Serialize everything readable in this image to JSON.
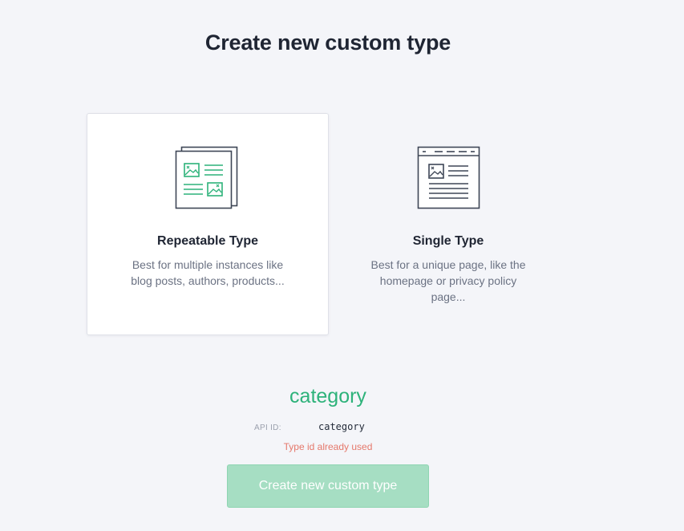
{
  "page_title": "Create new custom type",
  "types": [
    {
      "title": "Repeatable Type",
      "description": "Best for multiple instances like blog posts, authors, products...",
      "icon": "repeatable-type-icon",
      "selected": true
    },
    {
      "title": "Single Type",
      "description": "Best for a unique page, like the homepage or privacy policy page...",
      "icon": "single-type-icon",
      "selected": false
    }
  ],
  "form": {
    "type_name": "category",
    "api_id_label": "API ID:",
    "api_id_value": "category",
    "error": "Type id already used",
    "submit_label": "Create new custom type"
  },
  "colors": {
    "accent": "#2db27a",
    "icon_stroke": "#3e4656",
    "error": "#e5786b",
    "button_disabled": "#a6dec3"
  }
}
